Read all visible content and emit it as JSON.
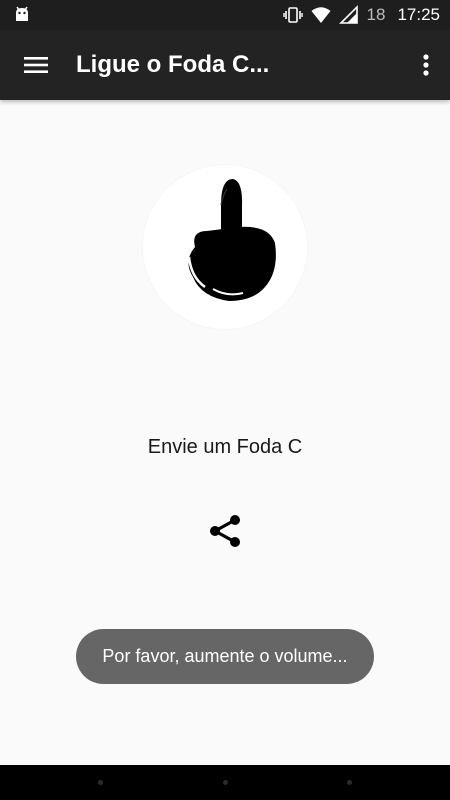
{
  "status_bar": {
    "app_icon": "android-icon",
    "icons": [
      "vibrate-icon",
      "wifi-icon",
      "signal-icon"
    ],
    "battery_level": "18",
    "time": "17:25"
  },
  "app_bar": {
    "title": "Ligue o Foda C...",
    "menu_icon": "hamburger-menu-icon",
    "overflow_icon": "more-vert-icon"
  },
  "main": {
    "logo_icon": "middle-finger-hand-icon",
    "caption": "Envie um Foda C",
    "share_icon": "share-icon"
  },
  "toast": {
    "text": "Por favor, aumente o volume..."
  },
  "nav_bar": {
    "buttons": [
      "back",
      "home",
      "recents"
    ]
  },
  "colors": {
    "app_bar": "#232323",
    "status_bar": "#1e1e1e",
    "background": "#fafafa",
    "toast": "#666666"
  }
}
